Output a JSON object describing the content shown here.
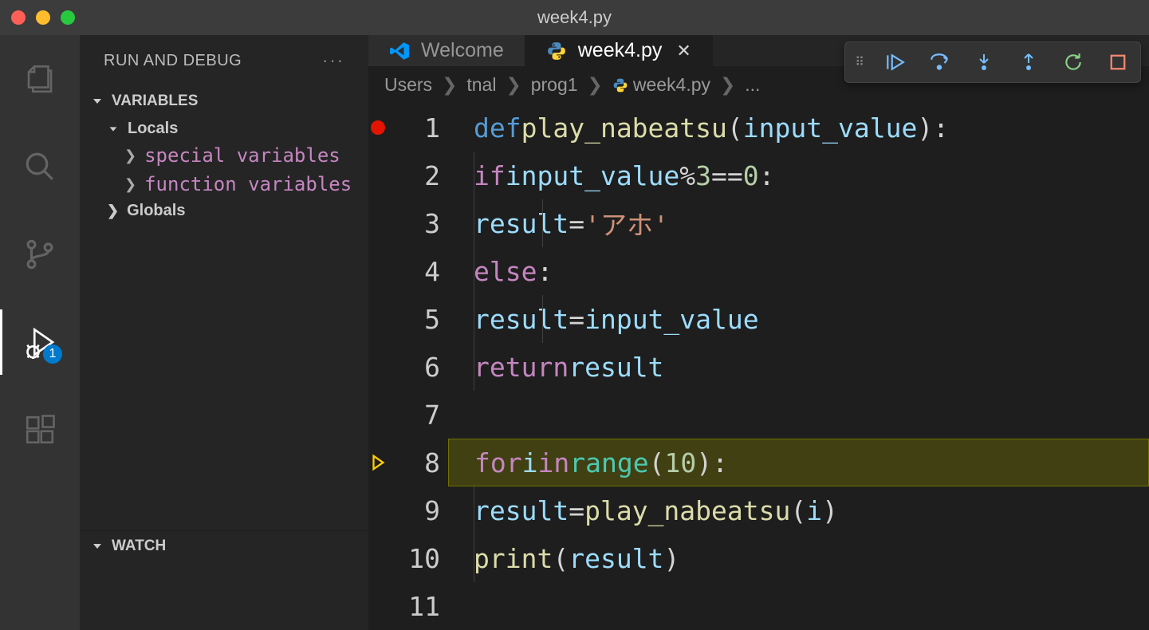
{
  "title": "week4.py",
  "sidebar": {
    "title": "RUN AND DEBUG",
    "sections": {
      "variables": "VARIABLES",
      "watch": "WATCH"
    },
    "locals": "Locals",
    "globals": "Globals",
    "special_vars": "special variables",
    "function_vars": "function variables"
  },
  "activity": {
    "debug_badge": "1"
  },
  "tabs": [
    {
      "label": "Welcome",
      "icon": "vscode",
      "active": false
    },
    {
      "label": "week4.py",
      "icon": "python",
      "active": true
    }
  ],
  "breadcrumb": [
    "Users",
    "tnal",
    "prog1",
    "week4.py",
    "..."
  ],
  "code": {
    "lines": [
      {
        "n": 1,
        "glyph": "breakpoint",
        "html": "<span class='def'>def</span> <span class='fn'>play_nabeatsu</span><span class='op'>(</span><span class='var'>input_value</span><span class='op'>):</span>"
      },
      {
        "n": 2,
        "indent": 1,
        "html": "    <span class='kw'>if</span> <span class='var'>input_value</span> <span class='op'>%</span> <span class='num'>3</span> <span class='op'>==</span> <span class='num'>0</span><span class='op'>:</span>"
      },
      {
        "n": 3,
        "indent": 2,
        "html": "        <span class='var'>result</span> <span class='op'>=</span> <span class='str'>'アホ'</span>"
      },
      {
        "n": 4,
        "indent": 1,
        "html": "    <span class='kw'>else</span><span class='op'>:</span>"
      },
      {
        "n": 5,
        "indent": 2,
        "html": "        <span class='var'>result</span> <span class='op'>=</span> <span class='var'>input_value</span>"
      },
      {
        "n": 6,
        "indent": 1,
        "html": "    <span class='kw'>return</span> <span class='var'>result</span>"
      },
      {
        "n": 7,
        "html": ""
      },
      {
        "n": 8,
        "glyph": "current",
        "current": true,
        "html": "<span class='kw'>for</span> <span class='var'>i</span> <span class='kw'>in</span> <span class='builtin'>range</span><span class='op'>(</span><span class='num'>10</span><span class='op'>):</span>"
      },
      {
        "n": 9,
        "indent": 1,
        "html": "    <span class='var'>result</span> <span class='op'>=</span> <span class='fn'>play_nabeatsu</span><span class='op'>(</span><span class='var'>i</span><span class='op'>)</span>"
      },
      {
        "n": 10,
        "indent": 1,
        "html": "    <span class='fn'>print</span><span class='op'>(</span><span class='var'>result</span><span class='op'>)</span>"
      },
      {
        "n": 11,
        "html": ""
      }
    ]
  }
}
